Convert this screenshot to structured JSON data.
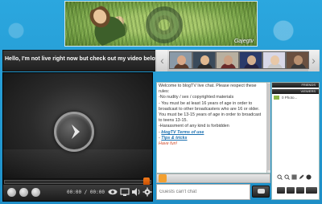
{
  "banner": {
    "tagline": "Gajegtv"
  },
  "header": {
    "offline_message": "Hello, I'm not live right now but check out my video below."
  },
  "thumbnails": [
    {
      "skin": "#d8a888",
      "shirt": "#5a3a2a",
      "bg": "#8a9aa8"
    },
    {
      "skin": "#e0b890",
      "shirt": "#2a2a2a",
      "bg": "#3a4a5a"
    },
    {
      "skin": "#caa084",
      "shirt": "#6a2a2a",
      "bg": "#b8b0a0"
    },
    {
      "skin": "#d4b090",
      "shirt": "#222244",
      "bg": "#2a3a6a"
    },
    {
      "skin": "#e8c8a8",
      "shirt": "#c8c8c8",
      "bg": "#d8d8e8"
    },
    {
      "skin": "#b89070",
      "shirt": "#3a3a3a",
      "bg": "#6a5040"
    }
  ],
  "player": {
    "time": "00:00 / 00:00",
    "progress": 0.0
  },
  "chat": {
    "lines": [
      "Welcome to blogTV live chat. Please respect these rules:",
      "-No nudity / sex / copyrighted materials",
      "- You must be at least 16 years of age in order to broadcast to other broadcasters who are 16 or older. You must be 13-15 years of age in order to broadcast to teens 13-15.",
      "-Harassment of any kind is forbidden"
    ],
    "links": [
      "blogTV Terms of use",
      "Tips & tricks"
    ],
    "closing": "Have fun!",
    "input_placeholder": "Guests can't chat"
  },
  "side": {
    "header1": "FRIENDS",
    "header2": "VIEWERS",
    "viewer_count_label": "0 Photo..."
  },
  "colors": {
    "page_bg": "#2a9fd6",
    "link": "#1a6fb0",
    "accent_orange": "#f07a1a"
  }
}
